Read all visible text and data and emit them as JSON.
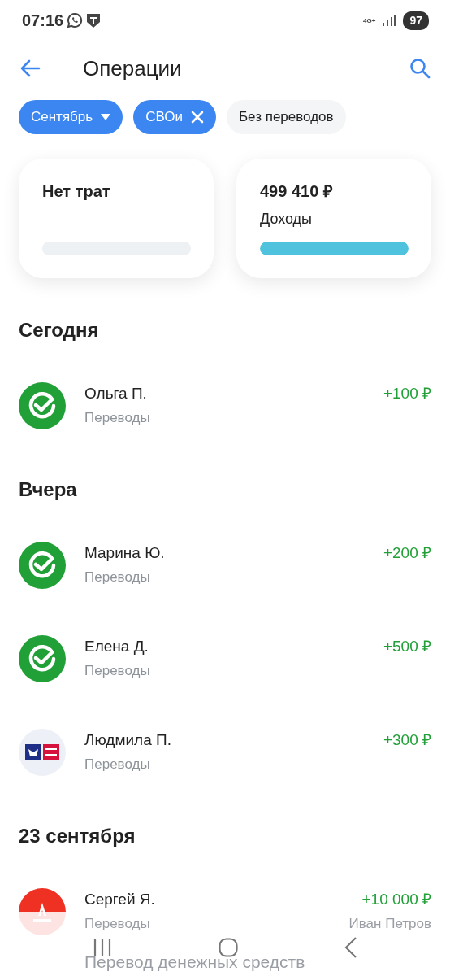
{
  "status_bar": {
    "time": "07:16",
    "network": "4G+",
    "battery": "97"
  },
  "header": {
    "title": "Операции"
  },
  "filters": [
    {
      "label": "Сентябрь",
      "kind": "dropdown",
      "selected": true
    },
    {
      "label": "СВОи",
      "kind": "removable",
      "selected": true
    },
    {
      "label": "Без переводов",
      "kind": "plain",
      "selected": false
    }
  ],
  "summary_cards": [
    {
      "title": "Нет трат",
      "level": 0
    },
    {
      "title": "499 410 ₽",
      "subtitle": "Доходы",
      "level": 1
    }
  ],
  "sections": [
    {
      "title": "Сегодня",
      "transactions": [
        {
          "name": "Ольга П.",
          "category": "Переводы",
          "amount": "+100 ₽",
          "kind": "check"
        }
      ]
    },
    {
      "title": "Вчера",
      "transactions": [
        {
          "name": "Марина Ю.",
          "category": "Переводы",
          "amount": "+200 ₽",
          "kind": "check"
        },
        {
          "name": "Елена Д.",
          "category": "Переводы",
          "amount": "+500 ₽",
          "kind": "check"
        },
        {
          "name": "Людмила П.",
          "category": "Переводы",
          "amount": "+300 ₽",
          "kind": "post"
        }
      ]
    },
    {
      "title": "23 сентября",
      "transactions": [
        {
          "name": "Сергей Я.",
          "category": "Переводы",
          "amount": "+10 000 ₽",
          "kind": "letter",
          "sender": "Иван Петров",
          "description": "Перевод денежных средств",
          "faded": true
        }
      ]
    }
  ]
}
